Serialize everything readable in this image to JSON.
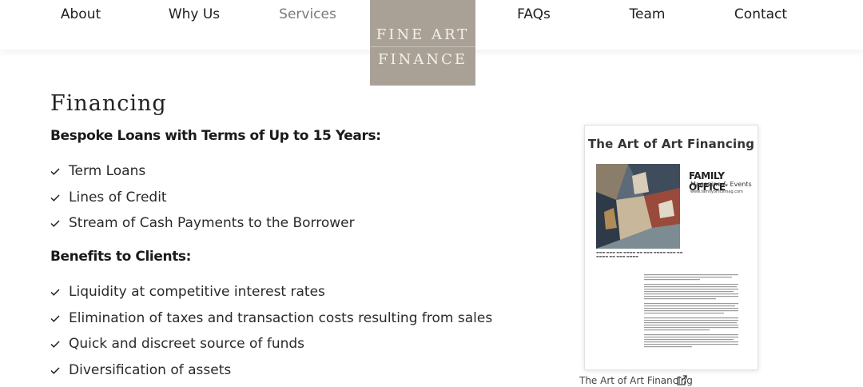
{
  "nav": {
    "items": [
      {
        "label": "About",
        "active": false
      },
      {
        "label": "Why Us",
        "active": false
      },
      {
        "label": "Services",
        "active": true
      },
      {
        "label": "FAQs",
        "active": false
      },
      {
        "label": "Team",
        "active": false
      },
      {
        "label": "Contact",
        "active": false
      }
    ],
    "active_color": "#7b7b7b"
  },
  "logo": {
    "line1": "FINE ART",
    "line2": "FINANCE",
    "background": "#aaa196"
  },
  "content": {
    "heading": "Financing",
    "section1": {
      "title": "Bespoke Loans with Terms of Up to 15 Years:",
      "items": [
        "Term Loans",
        "Lines of Credit",
        "Stream of Cash Payments to the Borrower"
      ]
    },
    "section2": {
      "title": "Benefits to Clients:",
      "items": [
        "Liquidity at competitive interest rates",
        "Elimination of taxes and transaction costs resulting from sales",
        "Quick and discreet source of funds",
        "Diversification of assets"
      ]
    },
    "check_icon": "check-icon"
  },
  "article": {
    "title": "The Art of Art Financing",
    "magazine": "FAMILY OFFICE",
    "magazine_sub": "Magazine & Events",
    "magazine_url": "www.familyofficemag.com",
    "link_text": "The Art of Art Financing",
    "link_icon": "external-link-icon"
  }
}
